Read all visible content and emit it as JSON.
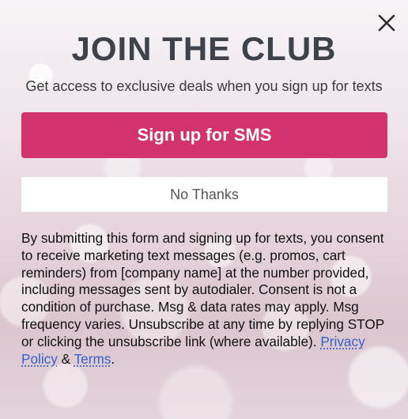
{
  "modal": {
    "title": "JOIN THE CLUB",
    "subtitle": "Get access to exclusive deals when you sign up for texts",
    "close_icon": "close-icon",
    "primary_button": "Sign up for SMS",
    "secondary_button": "No Thanks",
    "disclaimer": {
      "body": "By submitting this form and signing up for texts, you consent to receive marketing text messages (e.g. promos, cart reminders) from [company name] at the number provided, including messages sent by autodialer. Consent is not a condition of purchase. Msg & data rates may apply. Msg frequency varies. Unsubscribe at any time by replying STOP or clicking the unsubscribe link (where available). ",
      "privacy_link": "Privacy Policy",
      "joiner": " & ",
      "terms_link": "Terms",
      "end": "."
    }
  },
  "colors": {
    "accent": "#d3336c",
    "title": "#3e434b",
    "link": "#3560c9"
  }
}
